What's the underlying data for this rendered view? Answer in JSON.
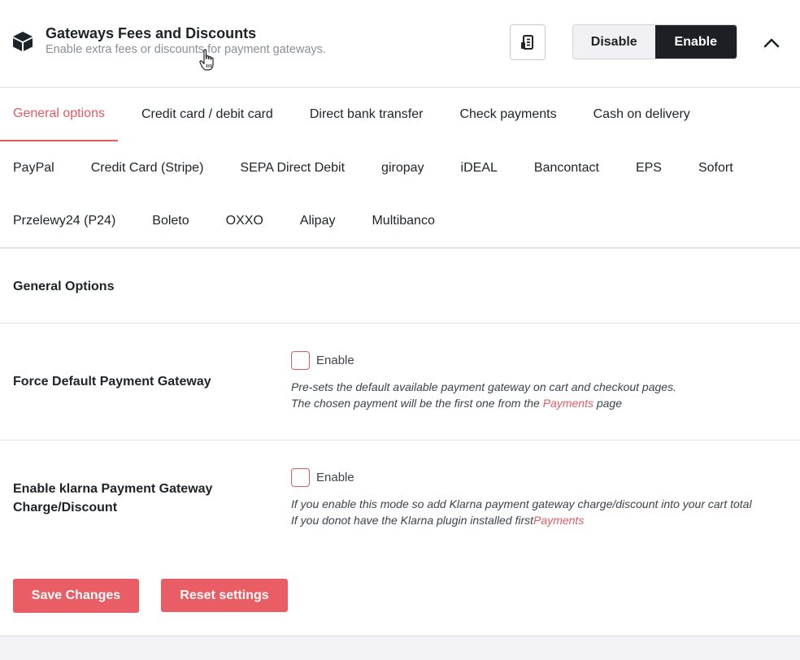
{
  "header": {
    "title": "Gateways Fees and Discounts",
    "subtitle": "Enable extra fees or discounts for payment gateways.",
    "disable_label": "Disable",
    "enable_label": "Enable"
  },
  "tabs": {
    "row1": [
      "General options",
      "Credit card / debit card",
      "Direct bank transfer",
      "Check payments",
      "Cash on delivery"
    ],
    "row2": [
      "PayPal",
      "Credit Card (Stripe)",
      "SEPA Direct Debit",
      "giropay",
      "iDEAL",
      "Bancontact",
      "EPS",
      "Sofort"
    ],
    "row3": [
      "Przelewy24 (P24)",
      "Boleto",
      "OXXO",
      "Alipay",
      "Multibanco"
    ]
  },
  "general": {
    "section_title": "General Options",
    "force_default": {
      "label": "Force Default Payment Gateway",
      "checkbox_label": "Enable",
      "desc_line1": "Pre-sets the default available payment gateway on cart and checkout pages.",
      "desc_line2_prefix": "The chosen payment will be the first one from the ",
      "desc_link": "Payments",
      "desc_line2_suffix": " page"
    },
    "klarna": {
      "label": "Enable klarna Payment Gateway Charge/Discount",
      "checkbox_label": "Enable",
      "desc_line1": "If you enable this mode so add Klarna payment gateway charge/discount into your cart total",
      "desc_line2_prefix": "If you donot have the Klarna plugin installed first",
      "desc_link": "Payments"
    }
  },
  "actions": {
    "save_label": "Save Changes",
    "reset_label": "Reset settings"
  },
  "colors": {
    "accent": "#e05a62",
    "button_red": "#e95d64",
    "dark": "#1e1f24"
  },
  "icons": [
    "box-icon",
    "hand-cursor-icon",
    "document-icon",
    "chevron-up-icon"
  ]
}
